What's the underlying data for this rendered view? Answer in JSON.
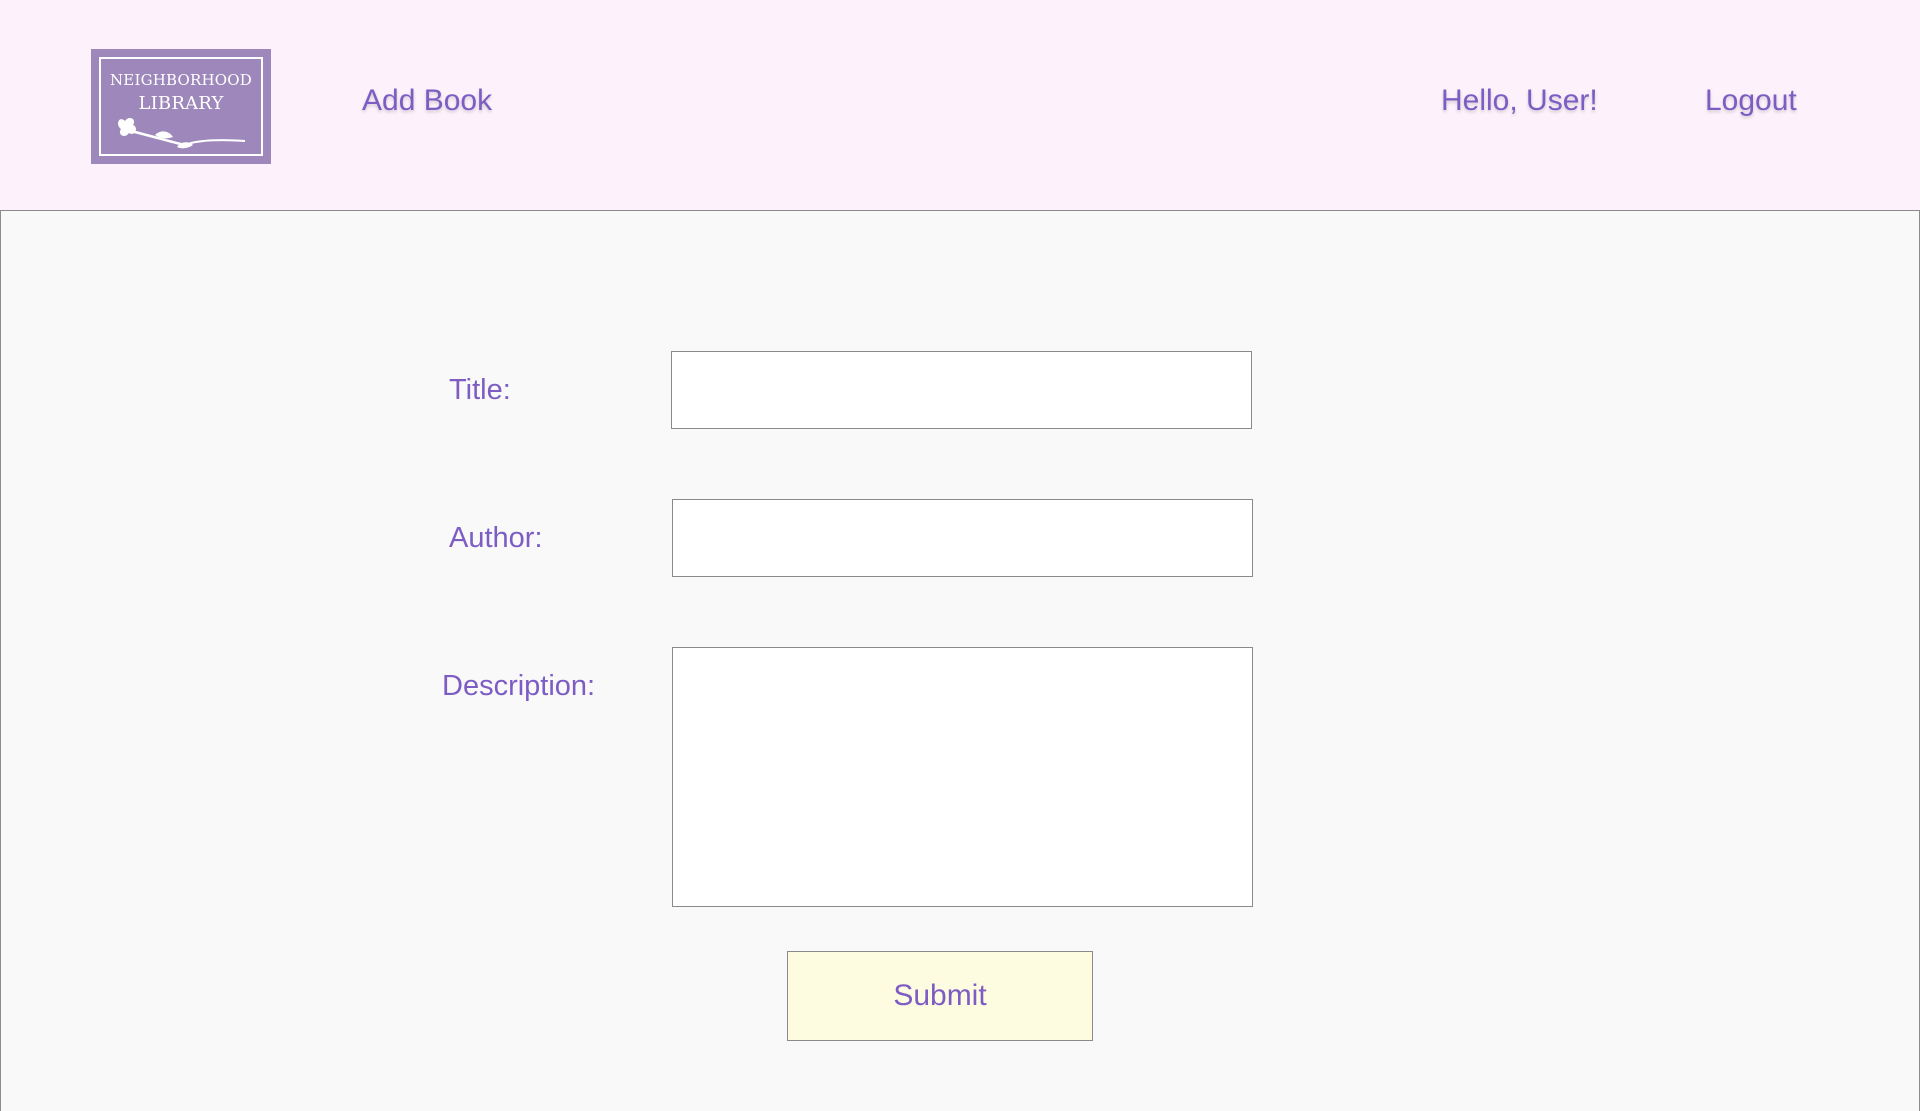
{
  "header": {
    "logo": {
      "line1": "NEIGHBORHOOD",
      "line2": "LIBRARY"
    },
    "nav": {
      "add_book": "Add Book",
      "greeting": "Hello, User!",
      "logout": "Logout"
    }
  },
  "form": {
    "title_label": "Title:",
    "title_value": "",
    "author_label": "Author:",
    "author_value": "",
    "description_label": "Description:",
    "description_value": "",
    "submit_label": "Submit"
  },
  "colors": {
    "accent": "#7d5cc4",
    "header_bg": "#fdf2fb",
    "main_bg": "#f9f9f9",
    "logo_bg": "#9e88bb",
    "submit_bg": "#fefce0"
  }
}
